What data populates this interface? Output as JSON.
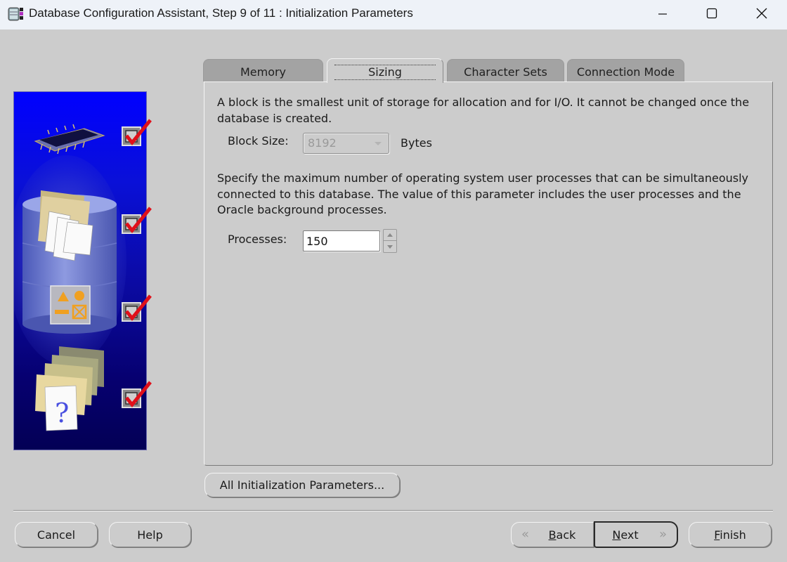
{
  "window": {
    "title": "Database Configuration Assistant, Step 9 of 11 : Initialization Parameters",
    "controls": {
      "minimize": "minimize",
      "maximize": "maximize",
      "close": "close"
    }
  },
  "illustration": {
    "steps": [
      {
        "icon": "memory-chip-icon",
        "checked": true
      },
      {
        "icon": "database-documents-icon",
        "checked": true
      },
      {
        "icon": "database-shapes-icon",
        "checked": true
      },
      {
        "icon": "folders-question-icon",
        "checked": true
      }
    ]
  },
  "tabs": [
    {
      "label": "Memory",
      "active": false
    },
    {
      "label": "Sizing",
      "active": true
    },
    {
      "label": "Character Sets",
      "active": false
    },
    {
      "label": "Connection Mode",
      "active": false
    }
  ],
  "sizing": {
    "block_desc": "A block is the smallest unit of storage for allocation and for I/O. It cannot be changed once the database is created.",
    "block_size_label": "Block Size:",
    "block_size_value": "8192",
    "block_size_unit": "Bytes",
    "processes_desc": "Specify the maximum number of operating system user processes that can be simultaneously connected to this database. The value of this parameter includes the user processes and the Oracle background processes.",
    "processes_label": "Processes:",
    "processes_value": "150"
  },
  "buttons": {
    "all_params": "All Initialization Parameters...",
    "cancel": "Cancel",
    "help": "Help",
    "back": "Back",
    "back_mnemonic": "B",
    "back_rest": "ack",
    "next_mnemonic": "N",
    "next_rest": "ext",
    "finish_mnemonic": "F",
    "finish_rest": "inish"
  },
  "colors": {
    "dialog_bg": "#cccccc",
    "titlebar_bg": "#eef2f8",
    "inactive_tab": "#a3a3a3",
    "illustration_top": "#0000ff",
    "illustration_bottom": "#030055",
    "check_red": "#e0101a"
  }
}
